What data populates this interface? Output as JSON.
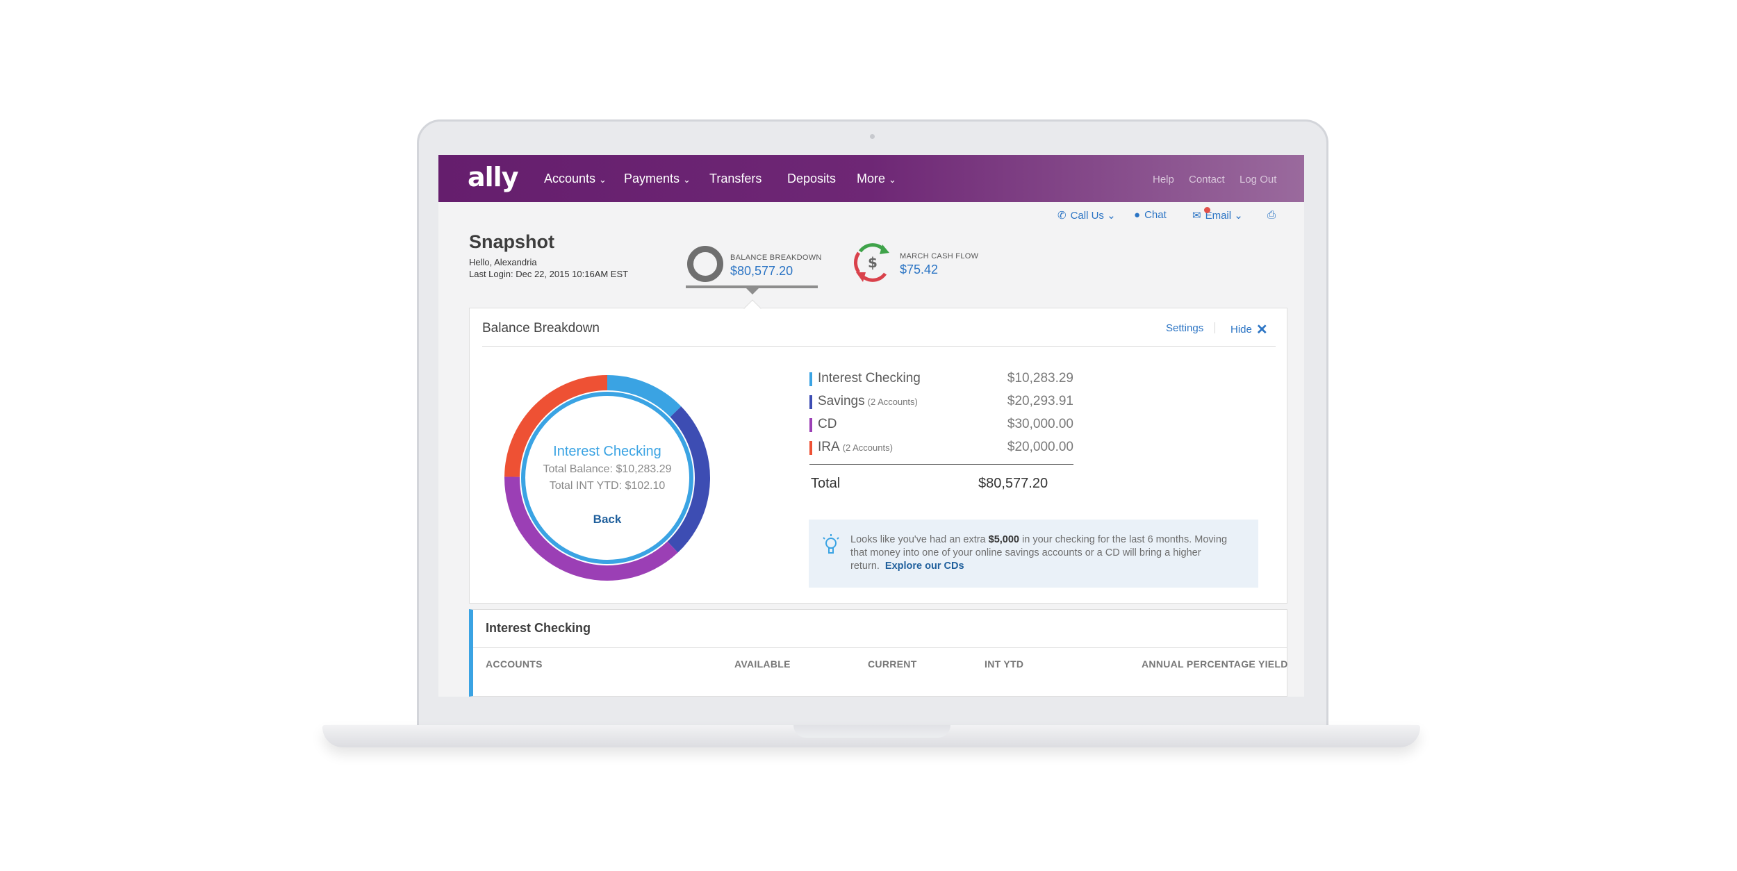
{
  "nav": {
    "logo": "ally",
    "items": [
      {
        "label": "Accounts",
        "dropdown": true
      },
      {
        "label": "Payments",
        "dropdown": true
      },
      {
        "label": "Transfers",
        "dropdown": false
      },
      {
        "label": "Deposits",
        "dropdown": false
      },
      {
        "label": "More",
        "dropdown": true
      }
    ],
    "utility": [
      "Help",
      "Contact",
      "Log Out"
    ],
    "gradient": [
      "#651e6d",
      "#9a6a9d"
    ]
  },
  "contact_bar": {
    "call_label": "Call Us",
    "chat_label": "Chat",
    "email_label": "Email",
    "icons": [
      "phone-icon",
      "chat-bubble-icon",
      "envelope-icon",
      "printer-icon"
    ]
  },
  "snapshot": {
    "title": "Snapshot",
    "greeting": "Hello, Alexandria",
    "last_login": "Last Login: Dec 22, 2015  10:16AM EST"
  },
  "summaries": {
    "balance": {
      "label": "BALANCE BREAKDOWN",
      "value": "$80,577.20"
    },
    "cashflow": {
      "label": "MARCH CASH FLOW",
      "value": "$75.42"
    }
  },
  "panel": {
    "title": "Balance Breakdown",
    "settings_label": "Settings",
    "hide_label": "Hide",
    "donut_center": {
      "title": "Interest Checking",
      "total_balance": "Total Balance: $10,283.29",
      "total_int": "Total INT YTD: $102.10",
      "back_label": "Back"
    },
    "accounts": [
      {
        "name": "Interest Checking",
        "sub": "",
        "amount": "$10,283.29",
        "value": 10283.29,
        "color": "#3aa3e3"
      },
      {
        "name": "Savings",
        "sub": "(2 Accounts)",
        "amount": "$20,293.91",
        "value": 20293.91,
        "color": "#3d4db3"
      },
      {
        "name": "CD",
        "sub": "",
        "amount": "$30,000.00",
        "value": 30000.0,
        "color": "#9b3fb5"
      },
      {
        "name": "IRA",
        "sub": "(2 Accounts)",
        "amount": "$20,000.00",
        "value": 20000.0,
        "color": "#ee5134"
      }
    ],
    "total_label": "Total",
    "total_value": "$80,577.20",
    "tip": {
      "pre": "Looks like you've had an extra ",
      "bold": "$5,000",
      "post": " in your checking for the last 6 months. Moving that money into one of your online savings accounts or a CD will bring a higher return.",
      "link": "Explore our CDs"
    }
  },
  "section": {
    "title": "Interest Checking",
    "columns": [
      "ACCOUNTS",
      "AVAILABLE",
      "CURRENT",
      "INT YTD",
      "ANNUAL PERCENTAGE YIELD"
    ]
  }
}
